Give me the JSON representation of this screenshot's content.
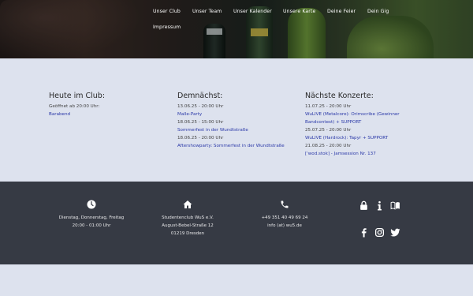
{
  "nav": {
    "items": [
      {
        "label": "Unser Club"
      },
      {
        "label": "Unser Team"
      },
      {
        "label": "Unser Kalender"
      },
      {
        "label": "Unsere Karte"
      },
      {
        "label": "Deine Feier"
      },
      {
        "label": "Dein Gig"
      },
      {
        "label": "Impressum"
      }
    ]
  },
  "today": {
    "heading": "Heute im Club:",
    "open_text": "Geöffnet ab 20:00 Uhr:",
    "event": "Barabend"
  },
  "upcoming": {
    "heading": "Demnächst:",
    "entries": [
      {
        "date": "13.06.25 - 20:00 Uhr",
        "title": "Malle-Party"
      },
      {
        "date": "18.06.25 - 15:00 Uhr",
        "title": "Sommerfest in der Wundtstraße"
      },
      {
        "date": "18.06.25 - 20:00 Uhr",
        "title": "Aftershowparty: Sommerfest in der Wundtstraße"
      }
    ]
  },
  "concerts": {
    "heading": "Nächste Konzerte:",
    "entries": [
      {
        "date": "11.07.25 - 20:00 Uhr",
        "title": "WuLIVE (Metalcore): Orimscribe (Gewinner Bandcontest) + SUPPORT"
      },
      {
        "date": "25.07.25 - 20:00 Uhr",
        "title": "WuLIVE (Hardrock): Tapyr + SUPPORT"
      },
      {
        "date": "21.08.25 - 20:00 Uhr",
        "title": "['wod.stok] - Jamsession Nr. 137"
      }
    ]
  },
  "footer": {
    "hours": {
      "icon": "clock-icon",
      "line1": "Dienstag, Donnerstag, Freitag",
      "line2": "20:00 - 01:00 Uhr"
    },
    "address": {
      "icon": "home-icon",
      "line1": "Studentenclub WuS e.V.",
      "line2": "August-Bebel-Straße 12",
      "line3": "01219 Dresden"
    },
    "contact": {
      "icon": "phone-icon",
      "line1": "+49 351 40 49 69 24",
      "line2": "info (at) wu5.de"
    },
    "links": [
      "lock-icon",
      "info-icon",
      "book-icon",
      "facebook-icon",
      "instagram-icon",
      "twitter-icon"
    ]
  },
  "colors": {
    "link": "#2b39a8",
    "footer_bg": "#363a44",
    "page_bg": "#dde2ee"
  }
}
